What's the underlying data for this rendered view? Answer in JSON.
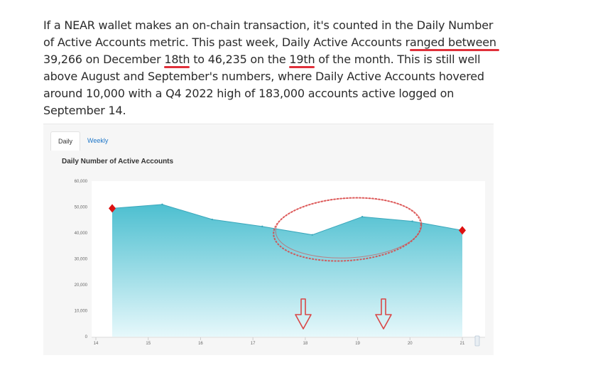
{
  "article": {
    "seg1": "If a NEAR wallet makes an on-chain transaction, it's counted in the Daily Number of Active Accounts metric. This past week, Daily Active Accounts r",
    "seg2": "anged between",
    "seg3": " 39,266 on December ",
    "seg4": "18th",
    "seg5": " to 46,235 on the ",
    "seg6": "19th",
    "seg7": " of the month. This is still well above August and September's numbers, where Daily Active Accounts hovered around 10,000 with a Q4 2022 high of 183,000 accounts active logged on September 14."
  },
  "widget": {
    "tabs": [
      "Daily",
      "Weekly"
    ],
    "active_tab": "Daily"
  },
  "colors": {
    "area_top": "#4dbfd0",
    "area_bottom": "#e6f8fb",
    "line": "#3aa7bb",
    "marker": "#dd1111",
    "annotation": "#d94747",
    "accent_tab": "#1d76c8"
  },
  "chart_data": {
    "type": "area",
    "title": "Daily Number of Active Accounts",
    "ylim": [
      0,
      60000
    ],
    "yticks": [
      "60,000",
      "50,000",
      "40,000",
      "30,000",
      "20,000",
      "10,000",
      "0"
    ],
    "xticks": [
      "14",
      "15",
      "16",
      "17",
      "18",
      "19",
      "20",
      "21"
    ],
    "x": [
      14,
      15,
      16,
      17,
      18,
      19,
      20,
      21
    ],
    "values": [
      49500,
      51000,
      45200,
      42500,
      39266,
      46235,
      44500,
      41000
    ],
    "grid": false,
    "annotations": [
      "red ellipse around 18–19",
      "down arrows under 18 and 19",
      "red markers at first and last points"
    ]
  }
}
